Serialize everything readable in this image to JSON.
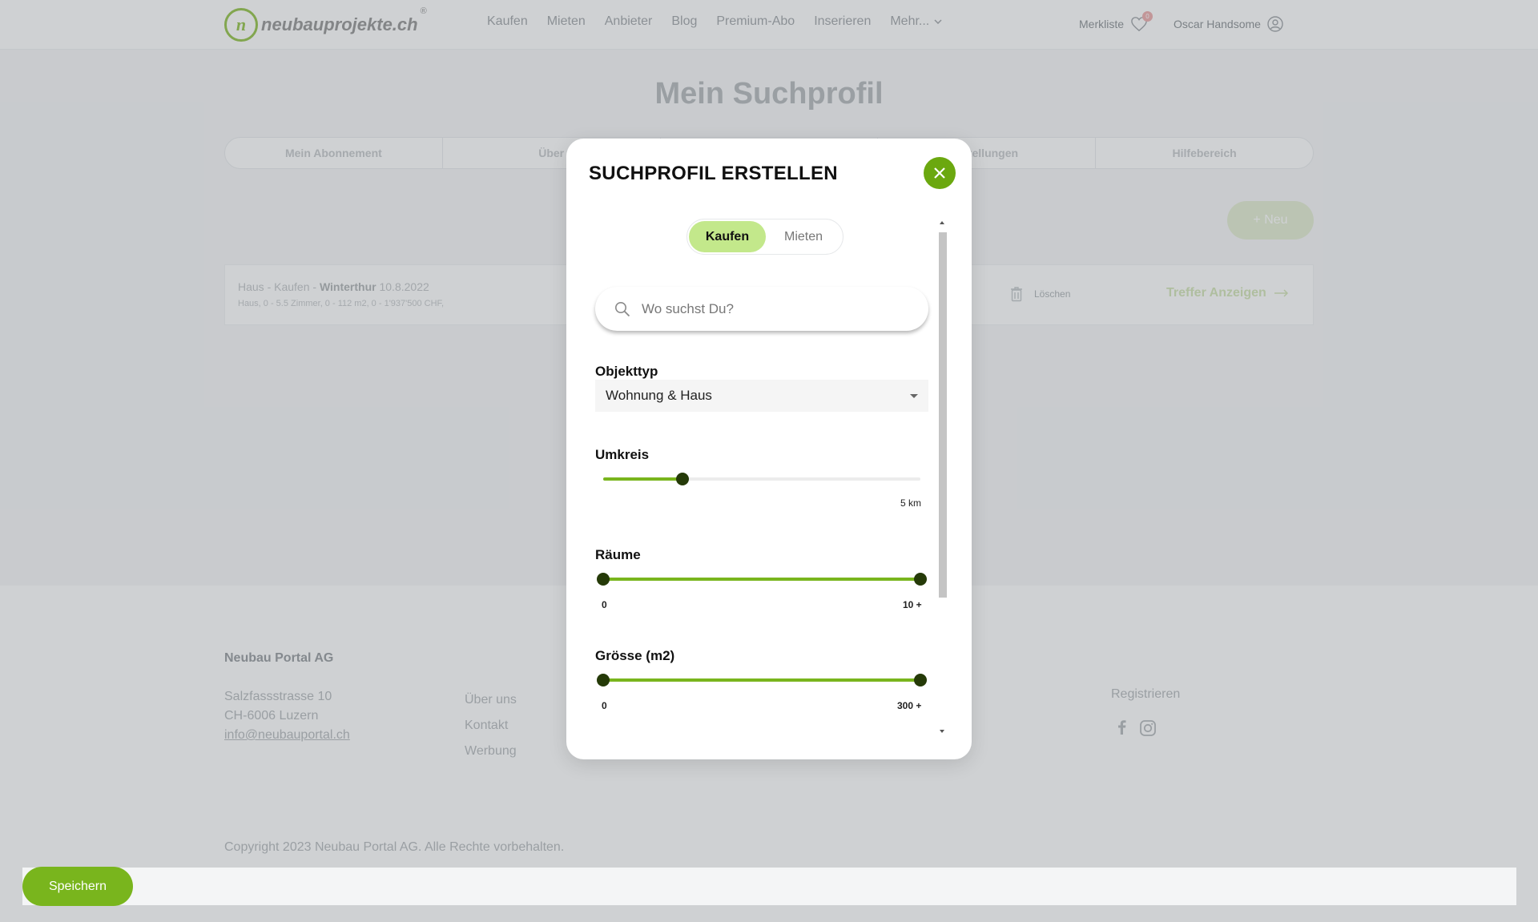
{
  "navbar": {
    "logo_text": "neubauprojekte.ch",
    "logo_mark": "n",
    "logo_reg": "®",
    "items": [
      {
        "label": "Kaufen"
      },
      {
        "label": "Mieten"
      },
      {
        "label": "Anbieter"
      },
      {
        "label": "Blog"
      },
      {
        "label": "Premium-Abo"
      },
      {
        "label": "Inserieren"
      },
      {
        "label": "Mehr...",
        "icon": "chevron-down-icon"
      }
    ],
    "merkliste_label": "Merkliste",
    "merkliste_count": "0",
    "user_name": "Oscar Handsome"
  },
  "page": {
    "title": "Mein Suchprofil",
    "tabs": [
      {
        "label": "Mein Abonnement"
      },
      {
        "label": "Über"
      },
      {
        "label": ""
      },
      {
        "label": "nstellungen"
      },
      {
        "label": "Hilfebereich"
      }
    ],
    "new_button": "+ Neu",
    "profile": {
      "prefix": "Haus - Kaufen - ",
      "city": "Winterthur",
      "date": " 10.8.2022",
      "details": "Haus, 0 - 5.5 Zimmer, 0 - 112 m2, 0 - 1'937'500 CHF,",
      "delete_label": "Löschen",
      "treffer_label": "Treffer Anzeigen"
    }
  },
  "footer": {
    "company": "Neubau Portal AG",
    "address_line1": "Salzfassstrasse 10",
    "address_line2": "CH-6006 Luzern",
    "email": "info@neubauportal.ch",
    "links": [
      {
        "label": "Über uns"
      },
      {
        "label": "Kontakt"
      },
      {
        "label": "Werbung"
      }
    ],
    "register": "Registrieren",
    "copyright": "Copyright 2023 Neubau Portal AG. Alle Rechte vorbehalten."
  },
  "save_button": "Speichern",
  "modal": {
    "title": "SUCHPROFIL ERSTELLEN",
    "toggle": {
      "active": "Kaufen",
      "inactive": "Mieten"
    },
    "search_placeholder": "Wo suchst Du?",
    "objekttyp": {
      "label": "Objekttyp",
      "selected": "Wohnung & Haus"
    },
    "umkreis": {
      "label": "Umkreis",
      "value_text": "5 km",
      "fraction": 0.25
    },
    "raeume": {
      "label": "Räume",
      "min_text": "0",
      "max_text": "10 +",
      "min_fraction": 0,
      "max_fraction": 1
    },
    "groesse": {
      "label": "Grösse (m2)",
      "min_text": "0",
      "max_text": "300 +",
      "min_fraction": 0,
      "max_fraction": 1
    }
  },
  "colors": {
    "brand_green": "#79b51d",
    "toggle_active": "#c3e88b",
    "slider_thumb": "#253a08"
  }
}
